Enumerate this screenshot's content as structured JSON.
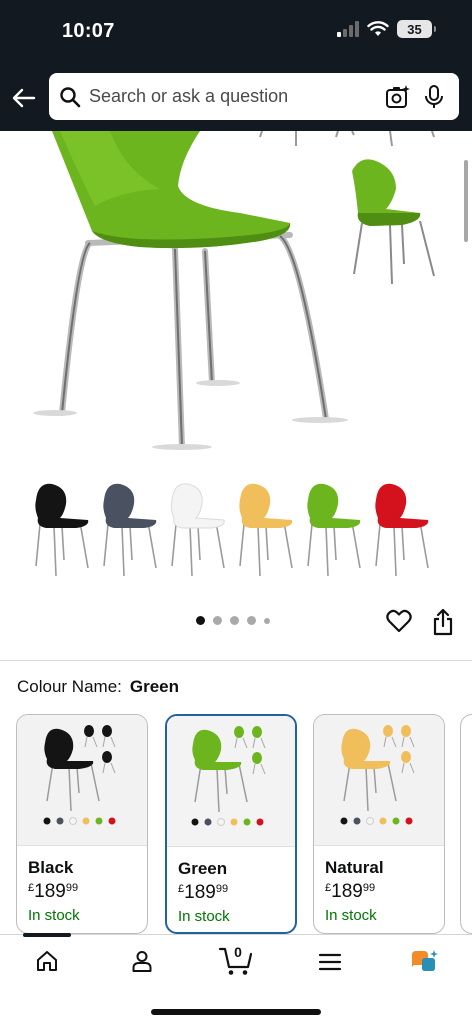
{
  "status_bar": {
    "time": "10:07",
    "battery": "35"
  },
  "search": {
    "placeholder": "Search or ask a question"
  },
  "product": {
    "colour_label": "Colour Name:",
    "colour_value": "Green",
    "swatches": [
      "Black",
      "Grey",
      "White",
      "Natural",
      "Green",
      "Red"
    ],
    "image_page": {
      "current": 1,
      "total": 5
    }
  },
  "variants": [
    {
      "name": "Black",
      "currency": "£",
      "whole": "189",
      "fraction": "99",
      "stock": "In stock",
      "selected": false
    },
    {
      "name": "Green",
      "currency": "£",
      "whole": "189",
      "fraction": "99",
      "stock": "In stock",
      "selected": true
    },
    {
      "name": "Natural",
      "currency": "£",
      "whole": "189",
      "fraction": "99",
      "stock": "In stock",
      "selected": false
    }
  ],
  "bottom_nav": {
    "cart_count": "0",
    "items": [
      "home-icon",
      "account-icon",
      "cart-icon",
      "menu-icon",
      "rufus-icon"
    ]
  },
  "colors": {
    "header_bg": "#131921",
    "accent_green": "#7cba27",
    "selected_border": "#2162a1",
    "stock_green": "#007600"
  }
}
